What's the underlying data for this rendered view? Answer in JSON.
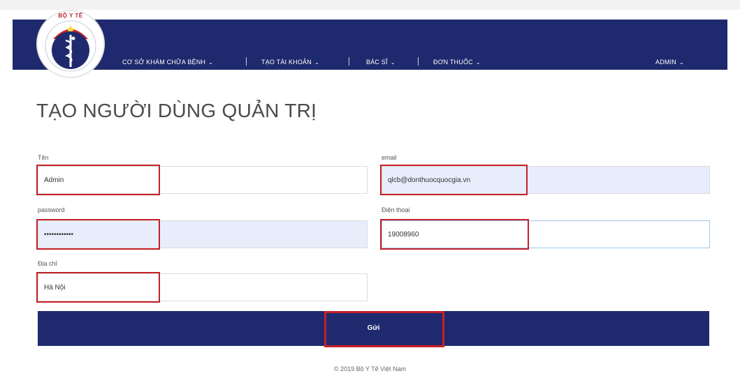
{
  "brand": {
    "logo_text": "BỘ Y TẾ"
  },
  "nav": {
    "items": [
      {
        "label": "CƠ SỞ KHÁM CHỮA BỆNH"
      },
      {
        "label": "TẠO TÀI KHOẢN"
      },
      {
        "label": "BÁC SĨ"
      },
      {
        "label": "ĐƠN THUỐC"
      }
    ],
    "admin_label": "ADMIN"
  },
  "page": {
    "title": "TẠO NGƯỜI DÙNG QUẢN TRỊ"
  },
  "form": {
    "name": {
      "label": "Tên",
      "value": "Admin"
    },
    "email": {
      "label": "email",
      "value": "qlcb@donthuocquocgia.vn"
    },
    "password": {
      "label": "password",
      "value": "••••••••••••"
    },
    "phone": {
      "label": "Điện thoại",
      "value": "19008960"
    },
    "address": {
      "label": "Địa chỉ",
      "value": "Hà Nội"
    }
  },
  "submit": {
    "label": "Gửi"
  },
  "footer": {
    "text": "© 2019 Bộ Y Tế Việt Nam"
  },
  "colors": {
    "navbar": "#1f2a6e",
    "highlight": "#c62028",
    "autofill": "#e8edfb"
  },
  "icons": {
    "logo": "caduceus-emblem",
    "dropdown": "chevron-down-icon"
  }
}
